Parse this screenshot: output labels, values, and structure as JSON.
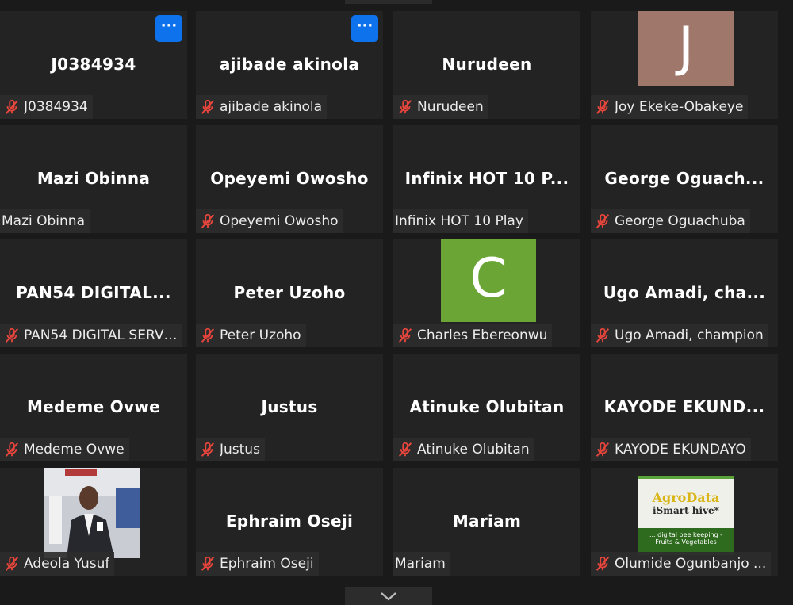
{
  "tiles": [
    {
      "name": "J0384934",
      "label": "J0384934",
      "muted": true,
      "more": true
    },
    {
      "name": "ajibade akinola",
      "label": "ajibade akinola",
      "muted": true,
      "more": true
    },
    {
      "name": "Nurudeen",
      "label": "Nurudeen",
      "muted": true
    },
    {
      "name": "",
      "label": "Joy Ekeke-Obakeye",
      "muted": true,
      "avatar_letter": "J",
      "avatar_color": "#a0776b"
    },
    {
      "name": "Mazi Obinna",
      "label": "Mazi Obinna",
      "muted": false
    },
    {
      "name": "Opeyemi Owosho",
      "label": "Opeyemi Owosho",
      "muted": true
    },
    {
      "name": "Infinix HOT 10 P...",
      "label": "Infinix HOT 10 Play",
      "muted": false
    },
    {
      "name": "George  Oguach...",
      "label": "George Oguachuba",
      "muted": true
    },
    {
      "name": "PAN54 DIGITAL...",
      "label": "PAN54 DIGITAL SERVI...",
      "muted": true
    },
    {
      "name": "Peter Uzoho",
      "label": "Peter Uzoho",
      "muted": true
    },
    {
      "name": "",
      "label": "Charles Ebereonwu",
      "muted": true,
      "avatar_letter": "C",
      "avatar_color": "#6aa536"
    },
    {
      "name": "Ugo  Amadi,  cha...",
      "label": "Ugo Amadi, champion",
      "muted": true
    },
    {
      "name": "Medeme Ovwe",
      "label": "Medeme Ovwe",
      "muted": true
    },
    {
      "name": "Justus",
      "label": "Justus",
      "muted": true
    },
    {
      "name": "Atinuke Olubitan",
      "label": "Atinuke Olubitan",
      "muted": true
    },
    {
      "name": "KAYODE  EKUND...",
      "label": "KAYODE EKUNDAYO",
      "muted": true
    },
    {
      "name": "",
      "label": "Adeola Yusuf",
      "muted": true,
      "photo": "person"
    },
    {
      "name": "Ephraim Oseji",
      "label": "Ephraim Oseji",
      "muted": true
    },
    {
      "name": "Mariam",
      "label": "Mariam",
      "muted": false
    },
    {
      "name": "",
      "label": "Olumide Ogunbanjo ...",
      "muted": true,
      "photo": "agrodata",
      "photo_text": {
        "title": "AgroData",
        "subtitle": "iSmart hive*",
        "line1": "... digital bee keeping -",
        "line2": "Fruits & Vegetables"
      }
    }
  ],
  "icons": {
    "more": "more-options-icon",
    "muted": "muted-mic-icon",
    "collapse": "chevron-down-icon"
  },
  "colors": {
    "background": "#1a1a1a",
    "tile": "#232323",
    "muted_red": "#e8453c",
    "accent": "#0e72ed"
  },
  "more_glyph": "···"
}
